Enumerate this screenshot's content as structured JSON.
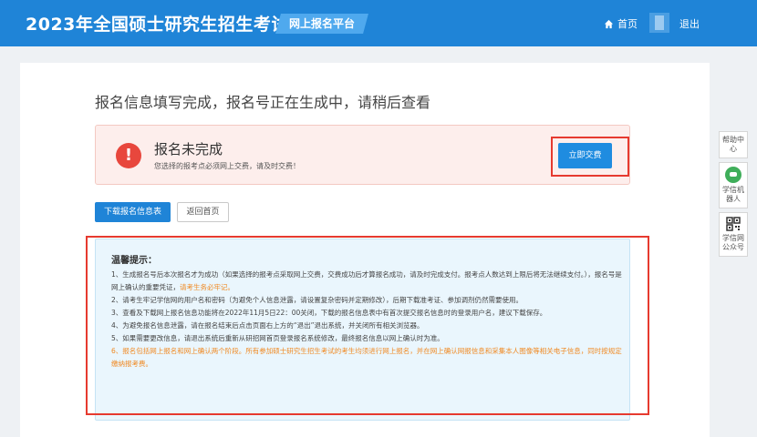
{
  "header": {
    "site_title": "2023年全国硕士研究生招生考试",
    "platform_tag": "网上报名平台",
    "home_label": "首页",
    "logout_label": "退出"
  },
  "page": {
    "heading": "报名信息填写完成，报名号正在生成中，请稍后查看"
  },
  "alert": {
    "icon_glyph": "!",
    "title": "报名未完成",
    "description": "您选择的报考点必须网上交费，请及时交费！",
    "pay_button": "立即交费"
  },
  "actions": {
    "download_label": "下载报名信息表",
    "home_label": "返回首页"
  },
  "tips": {
    "title": "温馨提示：",
    "item1": "1、生成报名号后本次报名才为成功（如果选择的报考点采取网上交费，交费成功后才算报名成功，请及时完成支付。报考点人数达到上限后将无法继续支付。），报名号是网上确认的重要凭证，",
    "item1_highlight": "请考生务必牢记。",
    "item2": "2、请考生牢记学信网的用户名和密码（为避免个人信息泄露，请设置复杂密码并定期修改），后期下载准考证、参加调剂仍然需要使用。",
    "item3": "3、查看及下载网上报名信息功能将在2022年11月5日22：00关闭，下载的报名信息表中有首次提交报名信息时的登录用户名，建议下载保存。",
    "item4": "4、为避免报名信息泄露，请在报名结束后点击页面右上方的“退出”退出系统，并关闭所有相关浏览器。",
    "item5": "5、如果需要更改信息，请退出系统后重新从研招网首页登录报名系统修改，最终报名信息以网上确认时为准。",
    "item6": "6、报名包括网上报名和网上确认两个阶段。所有参加硕士研究生招生考试的考生均须进行网上报名，并在网上确认网报信息和采集本人图像等相关电子信息，同时按规定缴纳报考费。"
  },
  "float_panel": {
    "help": "帮助中心",
    "robot": "学信机器人",
    "wechat": "学信网公众号"
  },
  "colors": {
    "header_bg": "#1f84d7",
    "alert_red": "#e8473d",
    "highlight_orange": "#f08a24",
    "tips_bg": "#eaf6fd"
  }
}
